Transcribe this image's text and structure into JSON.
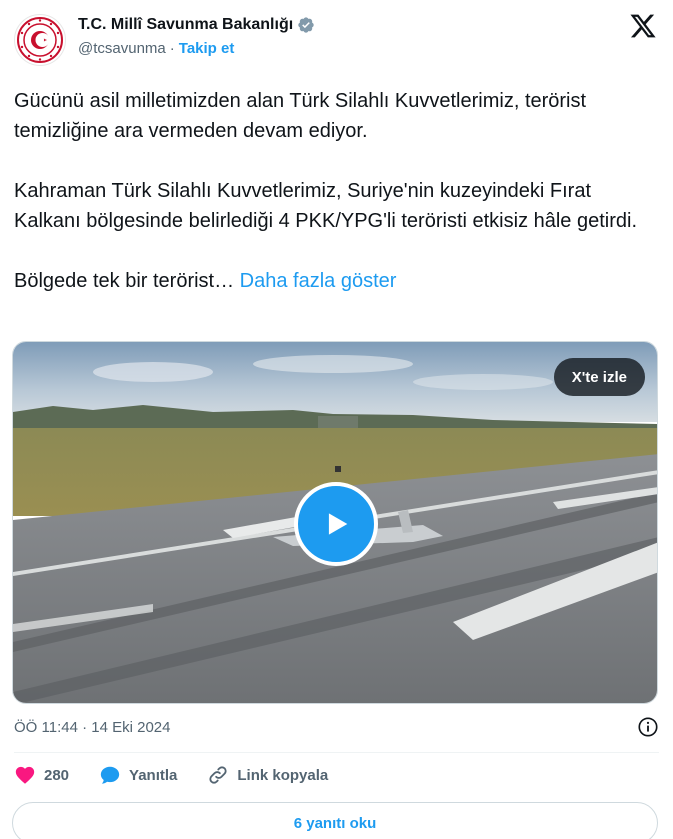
{
  "author": {
    "display_name": "T.C. Millî Savunma Bakanlığı",
    "handle": "@tcsavunma",
    "separator": "·",
    "follow_label": "Takip et",
    "verified_color": "#829aab"
  },
  "tweet": {
    "paragraphs": [
      "Gücünü asil milletimizden alan Türk Silahlı Kuvvetlerimiz, terörist temizliğine ara vermeden devam ediyor.",
      "Kahraman Türk Silahlı Kuvvetlerimiz, Suriye'nin kuzeyindeki Fırat Kalkanı bölgesinde belirlediği 4 PKK/YPG'li teröristi etkisiz hâle getirdi."
    ],
    "truncated_text": "Bölgede tek bir terörist…",
    "show_more_label": "Daha fazla göster"
  },
  "video": {
    "watch_label": "X'te izle",
    "play_icon": "play-icon"
  },
  "meta": {
    "timestamp": "ÖÖ 11:44 · 14 Eki 2024",
    "info_icon": "info-icon"
  },
  "actions": {
    "like_count": "280",
    "reply_label": "Yanıtla",
    "copy_link_label": "Link kopyala"
  },
  "replies_button_label": "6 yanıtı oku",
  "colors": {
    "accent": "#1d9bf0",
    "like": "#f91880",
    "text": "#0f1419",
    "muted": "#536471"
  }
}
